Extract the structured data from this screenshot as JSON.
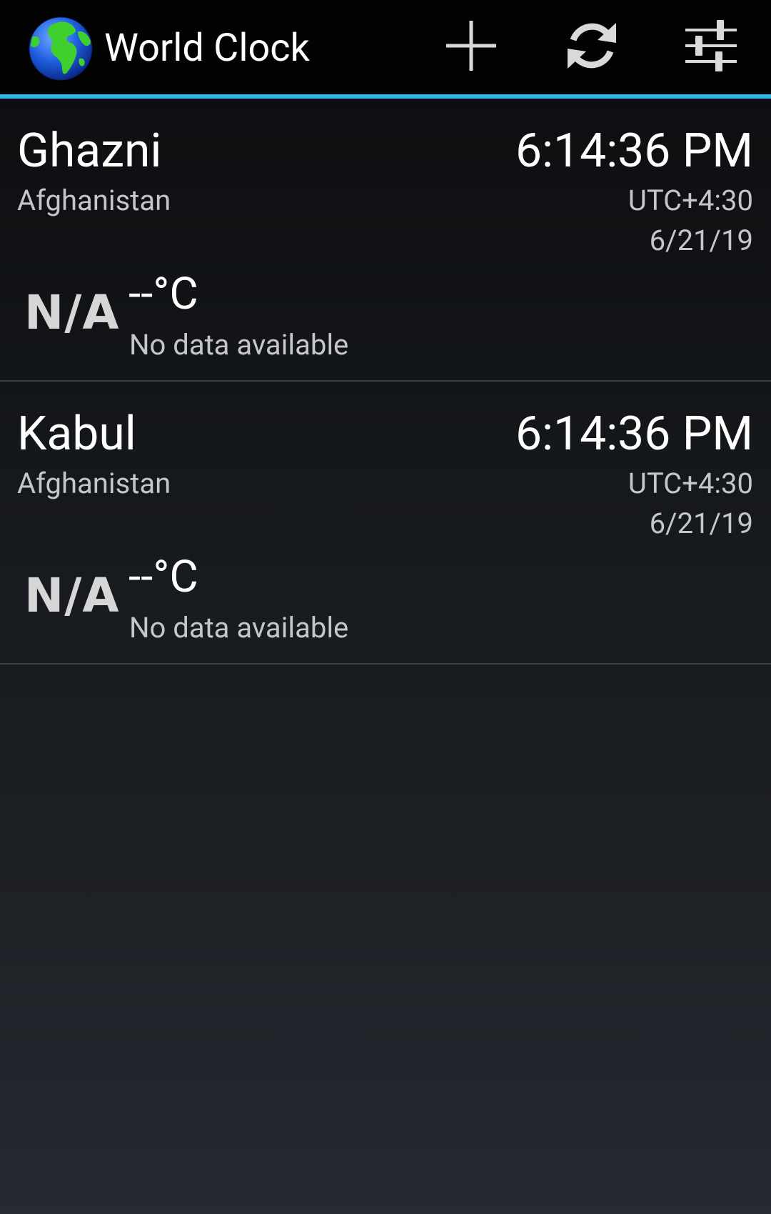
{
  "app": {
    "title": "World Clock",
    "icon": "globe-icon",
    "accent_color": "#33b5e5"
  },
  "actions": [
    {
      "name": "add-clock-button",
      "icon": "plus-icon"
    },
    {
      "name": "refresh-button",
      "icon": "refresh-icon"
    },
    {
      "name": "settings-button",
      "icon": "sliders-icon"
    }
  ],
  "clocks": [
    {
      "city": "Ghazni",
      "country": "Afghanistan",
      "time": "6:14:36 PM",
      "utc_offset": "UTC+4:30",
      "date": "6/21/19",
      "weather_icon_text": "N/A",
      "temperature": "--°C",
      "weather_desc": "No data available"
    },
    {
      "city": "Kabul",
      "country": "Afghanistan",
      "time": "6:14:36 PM",
      "utc_offset": "UTC+4:30",
      "date": "6/21/19",
      "weather_icon_text": "N/A",
      "temperature": "--°C",
      "weather_desc": "No data available"
    }
  ]
}
